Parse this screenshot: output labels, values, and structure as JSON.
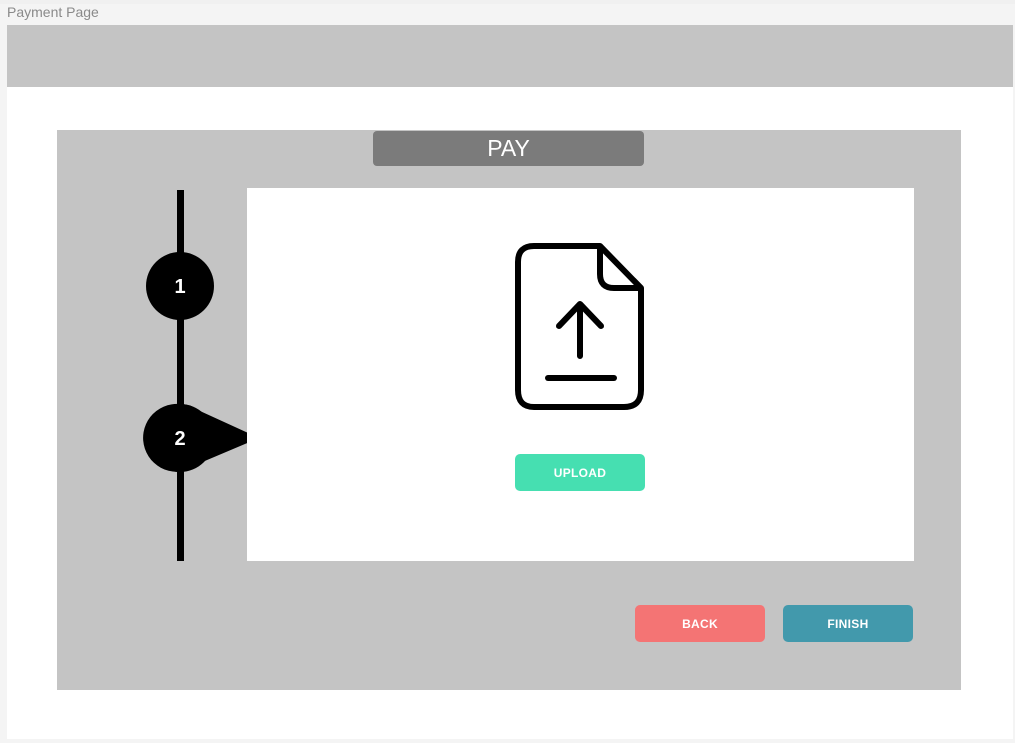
{
  "page": {
    "label": "Payment Page"
  },
  "header": {
    "title": "PAY"
  },
  "steps": [
    {
      "number": "1",
      "state": "done"
    },
    {
      "number": "2",
      "state": "current"
    }
  ],
  "upload": {
    "icon": "file-upload-icon",
    "button_label": "UPLOAD"
  },
  "actions": {
    "back_label": "BACK",
    "finish_label": "FINISH"
  },
  "colors": {
    "frame_bg": "#ffffff",
    "panel_bg": "#c4c4c4",
    "title_bg": "#7b7b7b",
    "upload": "#46dfb1",
    "back": "#f47474",
    "finish": "#4299ac",
    "step": "#000000"
  }
}
